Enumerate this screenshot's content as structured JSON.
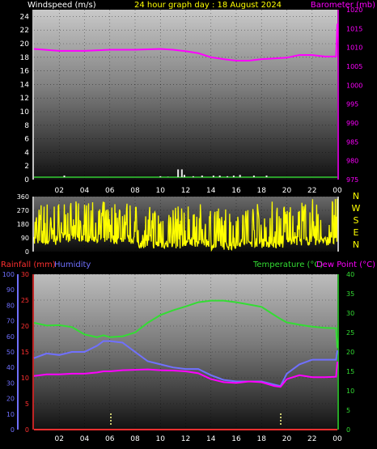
{
  "title": "24 hour graph day : 18 August 2024",
  "colors": {
    "title": "#ffff00",
    "wind": "#ffffff",
    "baro": "#ff00ff",
    "dir": "#ffff00",
    "rain": "#ff3030",
    "humidity": "#7070ff",
    "temp": "#33dd33",
    "dew": "#ff00ff",
    "axis_white": "#ffffff"
  },
  "x_ticks": [
    "02",
    "04",
    "06",
    "08",
    "10",
    "12",
    "14",
    "16",
    "18",
    "20",
    "22",
    "00"
  ],
  "chart_data": [
    {
      "type": "line",
      "panel": "wind-baro",
      "left_label": "Windspeed (m/s)",
      "right_label": "Barometer (mb)",
      "left_ticks": [
        0,
        2,
        4,
        6,
        8,
        10,
        12,
        14,
        16,
        18,
        20,
        22,
        24
      ],
      "right_ticks": [
        975,
        980,
        985,
        990,
        995,
        1000,
        1005,
        1010,
        1015,
        1020
      ],
      "left_range": [
        0,
        25
      ],
      "right_range": [
        975,
        1020
      ],
      "x": [
        0,
        2,
        4,
        6,
        8,
        10,
        11,
        12,
        13,
        14,
        15,
        16,
        17,
        18,
        19,
        20,
        21,
        22,
        23,
        23.9,
        24
      ],
      "series": [
        {
          "name": "Barometer (mb)",
          "axis": "right",
          "values": [
            1009.6,
            1009.1,
            1009.1,
            1009.4,
            1009.4,
            1009.6,
            1009.4,
            1009.0,
            1008.5,
            1007.4,
            1006.9,
            1006.5,
            1006.5,
            1006.9,
            1007.1,
            1007.3,
            1008.0,
            1008.0,
            1007.6,
            1007.6,
            1016.3
          ]
        },
        {
          "name": "Windspeed (m/s)",
          "axis": "left",
          "style": "bars",
          "points": [
            [
              2.4,
              0.6
            ],
            [
              10.0,
              0.5
            ],
            [
              10.6,
              0.4
            ],
            [
              11.4,
              1.5
            ],
            [
              11.7,
              1.5
            ],
            [
              11.9,
              0.7
            ],
            [
              12.6,
              0.5
            ],
            [
              13.3,
              0.6
            ],
            [
              14.2,
              0.6
            ],
            [
              14.7,
              0.6
            ],
            [
              15.3,
              0.5
            ],
            [
              15.8,
              0.6
            ],
            [
              16.3,
              0.7
            ],
            [
              17.4,
              0.6
            ],
            [
              18.4,
              0.6
            ]
          ]
        }
      ]
    },
    {
      "type": "scatter",
      "panel": "wind-direction",
      "left_ticks": [
        0,
        90,
        180,
        270,
        360
      ],
      "right_labels": [
        "N",
        "W",
        "S",
        "E",
        "N"
      ],
      "y_range": [
        0,
        360
      ],
      "x_range": [
        0,
        24
      ],
      "bands": [
        [
          0,
          2,
          40,
          330
        ],
        [
          2,
          6,
          60,
          330
        ],
        [
          6,
          8,
          50,
          340
        ],
        [
          8,
          12,
          20,
          300
        ],
        [
          12,
          14,
          30,
          310
        ],
        [
          14,
          16,
          10,
          300
        ],
        [
          16,
          18,
          30,
          320
        ],
        [
          18,
          20,
          20,
          340
        ],
        [
          20,
          24,
          40,
          350
        ]
      ]
    },
    {
      "type": "line",
      "panel": "rain-hum-temp",
      "labels": {
        "rain": "Rainfall (mm)",
        "humidity": "Humidity",
        "temp": "Temperature (°C)",
        "dew": "Dew Point (°C)"
      },
      "humidity_ticks": [
        0,
        10,
        20,
        30,
        40,
        50,
        60,
        70,
        80,
        90,
        100
      ],
      "rain_ticks": [
        0,
        5,
        10,
        15,
        20,
        25,
        30
      ],
      "temp_ticks": [
        0,
        5,
        10,
        15,
        20,
        25,
        30,
        35,
        40
      ],
      "humidity_range": [
        0,
        100
      ],
      "rain_range": [
        0,
        30
      ],
      "temp_range": [
        0,
        40
      ],
      "x": [
        0,
        1,
        2,
        3,
        4,
        5,
        5.5,
        6,
        7,
        8,
        9,
        10,
        11,
        12,
        13,
        14,
        15,
        16,
        17,
        18,
        19,
        19.5,
        20,
        21,
        22,
        23,
        23.9,
        24
      ],
      "series": [
        {
          "name": "Temperature (°C)",
          "axis": "temp",
          "values": [
            27.5,
            26.8,
            26.9,
            26.4,
            24.5,
            23.8,
            24.3,
            23.8,
            24.0,
            25.0,
            27.5,
            29.5,
            30.7,
            31.7,
            32.8,
            33.2,
            33.2,
            32.8,
            32.2,
            31.6,
            29.5,
            28.5,
            27.6,
            27.0,
            26.5,
            26.2,
            26.1,
            21.0
          ]
        },
        {
          "name": "Humidity",
          "axis": "humidity",
          "values": [
            46,
            49,
            48,
            50,
            50,
            54,
            57,
            57,
            56,
            50,
            44,
            42,
            40,
            39,
            39,
            35,
            32,
            31,
            31,
            31,
            29,
            28,
            36,
            42,
            45,
            45,
            45,
            51
          ]
        },
        {
          "name": "Dew Point (°C)",
          "axis": "temp",
          "values": [
            13.8,
            14.2,
            14.2,
            14.4,
            14.4,
            14.7,
            15.0,
            15.0,
            15.3,
            15.4,
            15.5,
            15.3,
            15.2,
            15.0,
            14.5,
            13.0,
            12.2,
            12.0,
            12.4,
            12.2,
            11.2,
            11.0,
            13.0,
            14.0,
            13.5,
            13.5,
            13.6,
            17.5
          ]
        },
        {
          "name": "Rainfall (mm)",
          "axis": "rain",
          "values": [
            0,
            0,
            0,
            0,
            0,
            0,
            0,
            0,
            0,
            0,
            0,
            0,
            0,
            0,
            0,
            0,
            0,
            0,
            0,
            0,
            0,
            0,
            0,
            0,
            0,
            0,
            0,
            0
          ]
        }
      ]
    }
  ]
}
